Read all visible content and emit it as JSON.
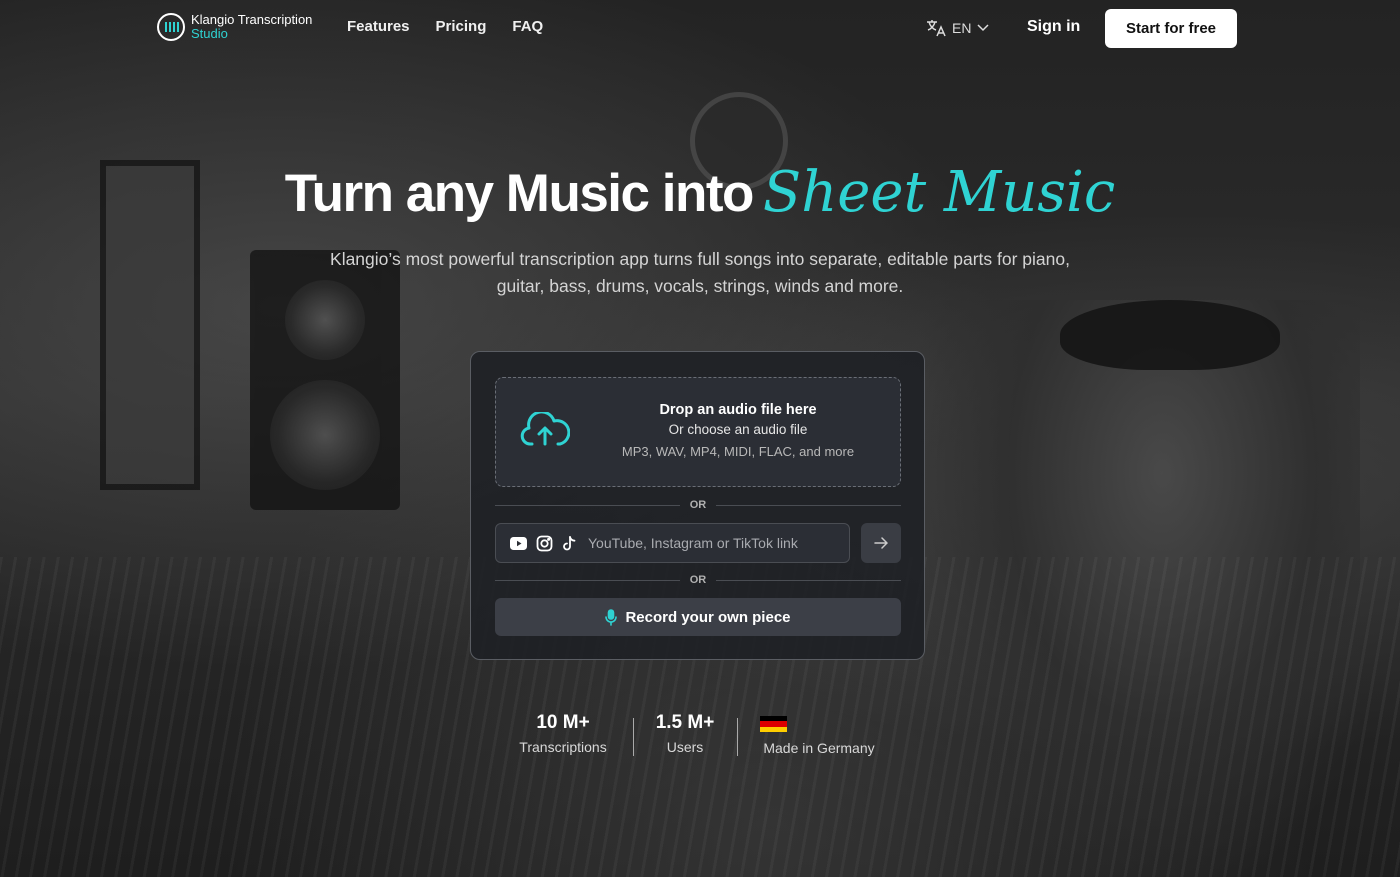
{
  "nav": {
    "logo_line1": "Klangio Transcription",
    "logo_line2": "Studio",
    "links": [
      "Features",
      "Pricing",
      "FAQ"
    ],
    "language": "EN",
    "sign_in": "Sign in",
    "cta": "Start for free"
  },
  "hero": {
    "title_plain": "Turn any Music into",
    "title_accent": "Sheet Music",
    "subtitle": "Klangio’s most powerful transcription app turns full songs into separate, editable parts for piano, guitar, bass, drums, vocals, strings, winds and more."
  },
  "upload": {
    "drop_title": "Drop an audio file here",
    "drop_choose": "Or choose an audio file",
    "drop_formats": "MP3, WAV, MP4, MIDI, FLAC, and more",
    "or_label": "OR",
    "link_placeholder": "YouTube, Instagram or TikTok link",
    "link_value": "",
    "record_label": "Record your own piece"
  },
  "stats": [
    {
      "value": "10 M+",
      "label": "Transcriptions"
    },
    {
      "value": "1.5 M+",
      "label": "Users"
    },
    {
      "value": "",
      "label": "Made in Germany"
    }
  ],
  "colors": {
    "accent": "#2fd3d3",
    "cta_bg": "#ffffff",
    "card_bg": "#1e2024"
  },
  "icons": [
    "klangio-logo-icon",
    "translate-icon",
    "chevron-down-icon",
    "cloud-upload-icon",
    "youtube-icon",
    "instagram-icon",
    "tiktok-icon",
    "arrow-right-icon",
    "microphone-icon",
    "germany-flag-icon"
  ]
}
